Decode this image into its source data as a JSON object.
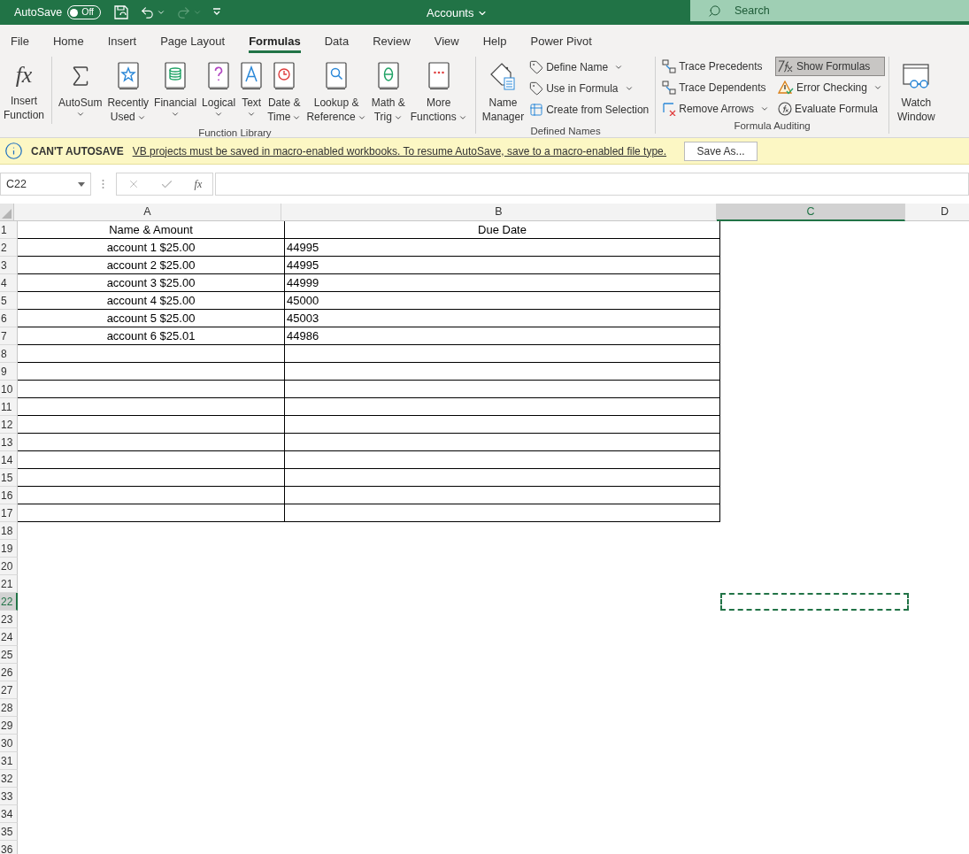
{
  "title_bar": {
    "autosave_label": "AutoSave",
    "autosave_toggle": {
      "on": false,
      "text": "Off"
    },
    "title": "Accounts",
    "search_placeholder": "Search"
  },
  "tabs": [
    {
      "label": "File",
      "selected": false
    },
    {
      "label": "Home",
      "selected": false
    },
    {
      "label": "Insert",
      "selected": false
    },
    {
      "label": "Page Layout",
      "selected": false
    },
    {
      "label": "Formulas",
      "selected": true
    },
    {
      "label": "Data",
      "selected": false
    },
    {
      "label": "Review",
      "selected": false
    },
    {
      "label": "View",
      "selected": false
    },
    {
      "label": "Help",
      "selected": false
    },
    {
      "label": "Power Pivot",
      "selected": false
    }
  ],
  "ribbon": {
    "function_library": {
      "name": "Function Library",
      "insert_function": {
        "glyph": "fx",
        "lines": [
          "Insert",
          "Function"
        ]
      },
      "buttons": [
        {
          "lines": [
            "AutoSum"
          ],
          "dropdown": true
        },
        {
          "lines": [
            "Recently",
            "Used"
          ],
          "dropdown": true
        },
        {
          "lines": [
            "Financial"
          ],
          "dropdown": true
        },
        {
          "lines": [
            "Logical"
          ],
          "dropdown": true
        },
        {
          "lines": [
            "Text"
          ],
          "dropdown": true
        },
        {
          "lines": [
            "Date &",
            "Time"
          ],
          "dropdown": true
        },
        {
          "lines": [
            "Lookup &",
            "Reference"
          ],
          "dropdown": true
        },
        {
          "lines": [
            "Math &",
            "Trig"
          ],
          "dropdown": true
        },
        {
          "lines": [
            "More",
            "Functions"
          ],
          "dropdown": true
        }
      ]
    },
    "defined_names": {
      "name": "Defined Names",
      "name_manager": {
        "lines": [
          "Name",
          "Manager"
        ]
      },
      "items": [
        {
          "label": "Define Name",
          "dropdown": true
        },
        {
          "label": "Use in Formula",
          "dropdown": true
        },
        {
          "label": "Create from Selection",
          "dropdown": false
        }
      ]
    },
    "formula_auditing": {
      "name": "Formula Auditing",
      "items": [
        {
          "label": "Trace Precedents",
          "dropdown": false,
          "pressed": false
        },
        {
          "label": "Trace Dependents",
          "dropdown": false,
          "pressed": false
        },
        {
          "label": "Remove Arrows",
          "dropdown": true,
          "pressed": false
        },
        {
          "label": "Show Formulas",
          "dropdown": false,
          "pressed": true
        },
        {
          "label": "Error Checking",
          "dropdown": true,
          "pressed": false
        },
        {
          "label": "Evaluate Formula",
          "dropdown": false,
          "pressed": false
        }
      ],
      "watch_window": {
        "lines": [
          "Watch",
          "Window"
        ]
      }
    }
  },
  "message_bar": {
    "title": "CAN'T AUTOSAVE",
    "message": "VB projects must be saved in macro-enabled workbooks. To resume AutoSave, save to a macro-enabled file type.",
    "button": "Save As..."
  },
  "formula_bar": {
    "name_box": "C22",
    "function_glyph": "fx"
  },
  "sheet": {
    "columns": [
      {
        "label": "A",
        "selected": false
      },
      {
        "label": "B",
        "selected": false
      },
      {
        "label": "C",
        "selected": true
      },
      {
        "label": "D",
        "selected": false
      }
    ],
    "rows": [
      {
        "header": "1",
        "selected": false,
        "bordered": true,
        "cells": [
          {
            "text": "Name & Amount",
            "centered": true
          },
          {
            "text": "Due Date",
            "centered": true
          }
        ]
      },
      {
        "header": "2",
        "selected": false,
        "bordered": true,
        "cells": [
          {
            "text": "account 1 $25.00",
            "centered": true
          },
          {
            "text": "44995",
            "centered": false
          }
        ]
      },
      {
        "header": "3",
        "selected": false,
        "bordered": true,
        "cells": [
          {
            "text": "account 2 $25.00",
            "centered": true
          },
          {
            "text": "44995",
            "centered": false
          }
        ]
      },
      {
        "header": "4",
        "selected": false,
        "bordered": true,
        "cells": [
          {
            "text": "account 3 $25.00",
            "centered": true
          },
          {
            "text": "44999",
            "centered": false
          }
        ]
      },
      {
        "header": "5",
        "selected": false,
        "bordered": true,
        "cells": [
          {
            "text": "account 4 $25.00",
            "centered": true
          },
          {
            "text": "45000",
            "centered": false
          }
        ]
      },
      {
        "header": "6",
        "selected": false,
        "bordered": true,
        "cells": [
          {
            "text": "account 5 $25.00",
            "centered": true
          },
          {
            "text": "45003",
            "centered": false
          }
        ]
      },
      {
        "header": "7",
        "selected": false,
        "bordered": true,
        "cells": [
          {
            "text": "account 6 $25.01",
            "centered": true
          },
          {
            "text": "44986",
            "centered": false
          }
        ]
      },
      {
        "header": "8",
        "selected": false,
        "bordered": true
      },
      {
        "header": "9",
        "selected": false,
        "bordered": true
      },
      {
        "header": "10",
        "selected": false,
        "bordered": true
      },
      {
        "header": "11",
        "selected": false,
        "bordered": true
      },
      {
        "header": "12",
        "selected": false,
        "bordered": true
      },
      {
        "header": "13",
        "selected": false,
        "bordered": true
      },
      {
        "header": "14",
        "selected": false,
        "bordered": true
      },
      {
        "header": "15",
        "selected": false,
        "bordered": true
      },
      {
        "header": "16",
        "selected": false,
        "bordered": true
      },
      {
        "header": "17",
        "selected": false,
        "bordered": true
      },
      {
        "header": "18",
        "selected": false,
        "bordered": false
      },
      {
        "header": "19",
        "selected": false,
        "bordered": false
      },
      {
        "header": "20",
        "selected": false,
        "bordered": false
      },
      {
        "header": "21",
        "selected": false,
        "bordered": false
      },
      {
        "header": "22",
        "selected": true,
        "bordered": false
      },
      {
        "header": "23",
        "selected": false,
        "bordered": false
      },
      {
        "header": "24",
        "selected": false,
        "bordered": false
      },
      {
        "header": "25",
        "selected": false,
        "bordered": false
      },
      {
        "header": "26",
        "selected": false,
        "bordered": false
      },
      {
        "header": "27",
        "selected": false,
        "bordered": false
      },
      {
        "header": "28",
        "selected": false,
        "bordered": false
      },
      {
        "header": "29",
        "selected": false,
        "bordered": false
      },
      {
        "header": "30",
        "selected": false,
        "bordered": false
      },
      {
        "header": "31",
        "selected": false,
        "bordered": false
      },
      {
        "header": "32",
        "selected": false,
        "bordered": false
      },
      {
        "header": "33",
        "selected": false,
        "bordered": false
      },
      {
        "header": "34",
        "selected": false,
        "bordered": false
      },
      {
        "header": "35",
        "selected": false,
        "bordered": false
      },
      {
        "header": "36",
        "selected": false,
        "bordered": false
      }
    ]
  }
}
